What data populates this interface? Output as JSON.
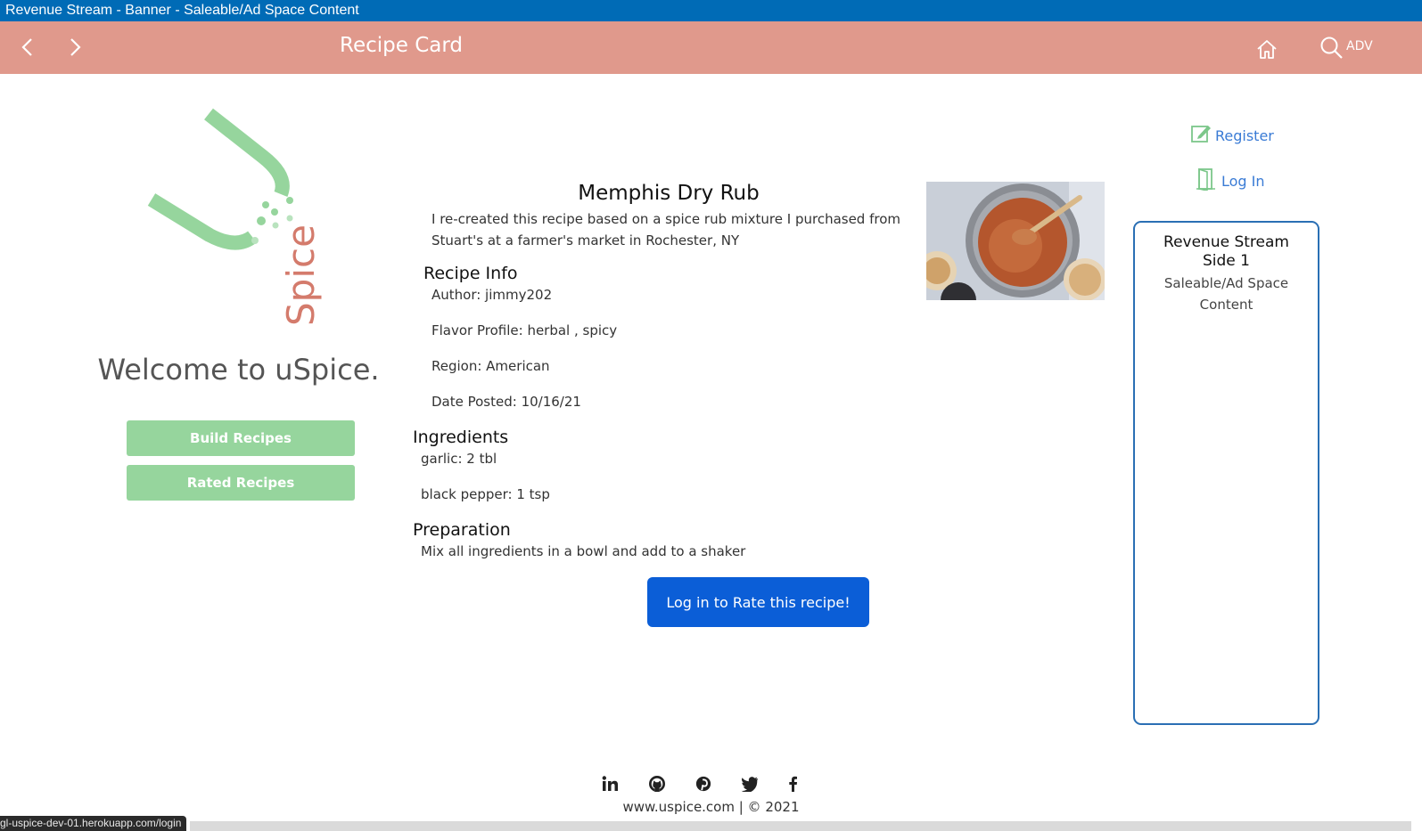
{
  "banner": {
    "title": "Revenue Stream - Banner - Saleable/Ad Space Content"
  },
  "navbar": {
    "title": "Recipe Card",
    "back_icon": "chevron-left-icon",
    "forward_icon": "chevron-right-icon",
    "home_icon": "home-icon",
    "search_icon": "search-icon",
    "search_label": "ADV",
    "bg_color": "#e0998c"
  },
  "sidebar": {
    "welcome": "Welcome to uSpice.",
    "logo_text": "Spice",
    "buttons": [
      {
        "label": "Build Recipes"
      },
      {
        "label": "Rated Recipes"
      }
    ],
    "accent": "#96d59d"
  },
  "recipe": {
    "title": "Memphis Dry Rub",
    "description": "I re-created this recipe based on a spice rub mixture I purchased from Stuart's at a farmer's market in Rochester, NY",
    "info_heading": "Recipe Info",
    "author": "Author: jimmy202",
    "flavor": "Flavor Profile: herbal , spicy",
    "region": "Region: American",
    "date": "Date Posted: 10/16/21",
    "ingredients_heading": "Ingredients",
    "ingredients": [
      "garlic: 2 tbl",
      "black pepper: 1 tsp"
    ],
    "preparation_heading": "Preparation",
    "preparation": "Mix all ingredients in a bowl and add to a shaker",
    "rate_button": "Log in to Rate this recipe!"
  },
  "auth": {
    "register": "Register",
    "login": "Log In",
    "register_icon": "edit-icon",
    "login_icon": "door-icon"
  },
  "ad": {
    "title": "Revenue Stream Side 1",
    "subtitle": "Saleable/Ad Space Content"
  },
  "footer": {
    "icons": [
      "linkedin-icon",
      "github-icon",
      "pinterest-icon",
      "twitter-icon",
      "facebook-icon"
    ],
    "text": "www.uspice.com | © 2021"
  },
  "status": {
    "url": "gl-uspice-dev-01.herokuapp.com/login"
  }
}
